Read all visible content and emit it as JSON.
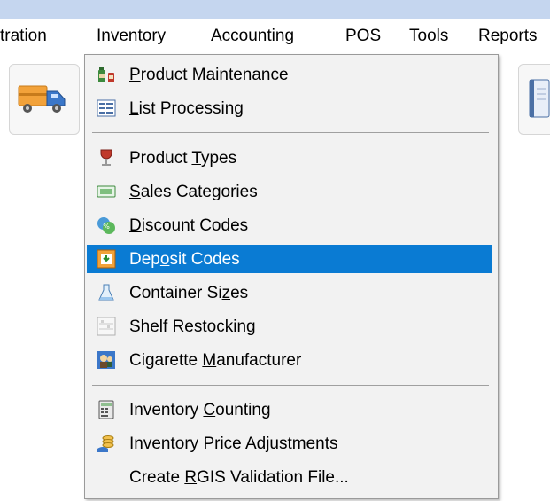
{
  "menubar": {
    "items": [
      {
        "label": "tration"
      },
      {
        "label": "Inventory"
      },
      {
        "label": "Accounting"
      },
      {
        "label": "POS"
      },
      {
        "label": "Tools"
      },
      {
        "label": "Reports"
      }
    ]
  },
  "inventory_menu": {
    "items": [
      {
        "pre": "",
        "key": "P",
        "post": "roduct Maintenance",
        "icon": "bottles-icon"
      },
      {
        "pre": "",
        "key": "L",
        "post": "ist Processing",
        "icon": "list-icon"
      },
      {
        "pre": "Product ",
        "key": "T",
        "post": "ypes",
        "icon": "wine-glass-icon"
      },
      {
        "pre": "",
        "key": "S",
        "post": "ales Categories",
        "icon": "category-icon"
      },
      {
        "pre": "",
        "key": "D",
        "post": "iscount Codes",
        "icon": "discount-icon"
      },
      {
        "pre": "Dep",
        "key": "o",
        "post": "sit Codes",
        "icon": "deposit-box-icon"
      },
      {
        "pre": "Container Si",
        "key": "z",
        "post": "es",
        "icon": "flask-icon"
      },
      {
        "pre": "Shelf Restoc",
        "key": "k",
        "post": "ing",
        "icon": "shelf-icon"
      },
      {
        "pre": "Cigarette ",
        "key": "M",
        "post": "anufacturer",
        "icon": "manufacturer-icon"
      },
      {
        "pre": "Inventory ",
        "key": "C",
        "post": "ounting",
        "icon": "calculator-icon"
      },
      {
        "pre": "Inventory ",
        "key": "P",
        "post": "rice Adjustments",
        "icon": "coins-icon"
      },
      {
        "pre": "Create ",
        "key": "R",
        "post": "GIS Validation File...",
        "icon": ""
      }
    ]
  },
  "colors": {
    "selection": "#0a7bd3",
    "title_bar": "#c5d6ef",
    "menu_bg": "#f2f2f2"
  }
}
